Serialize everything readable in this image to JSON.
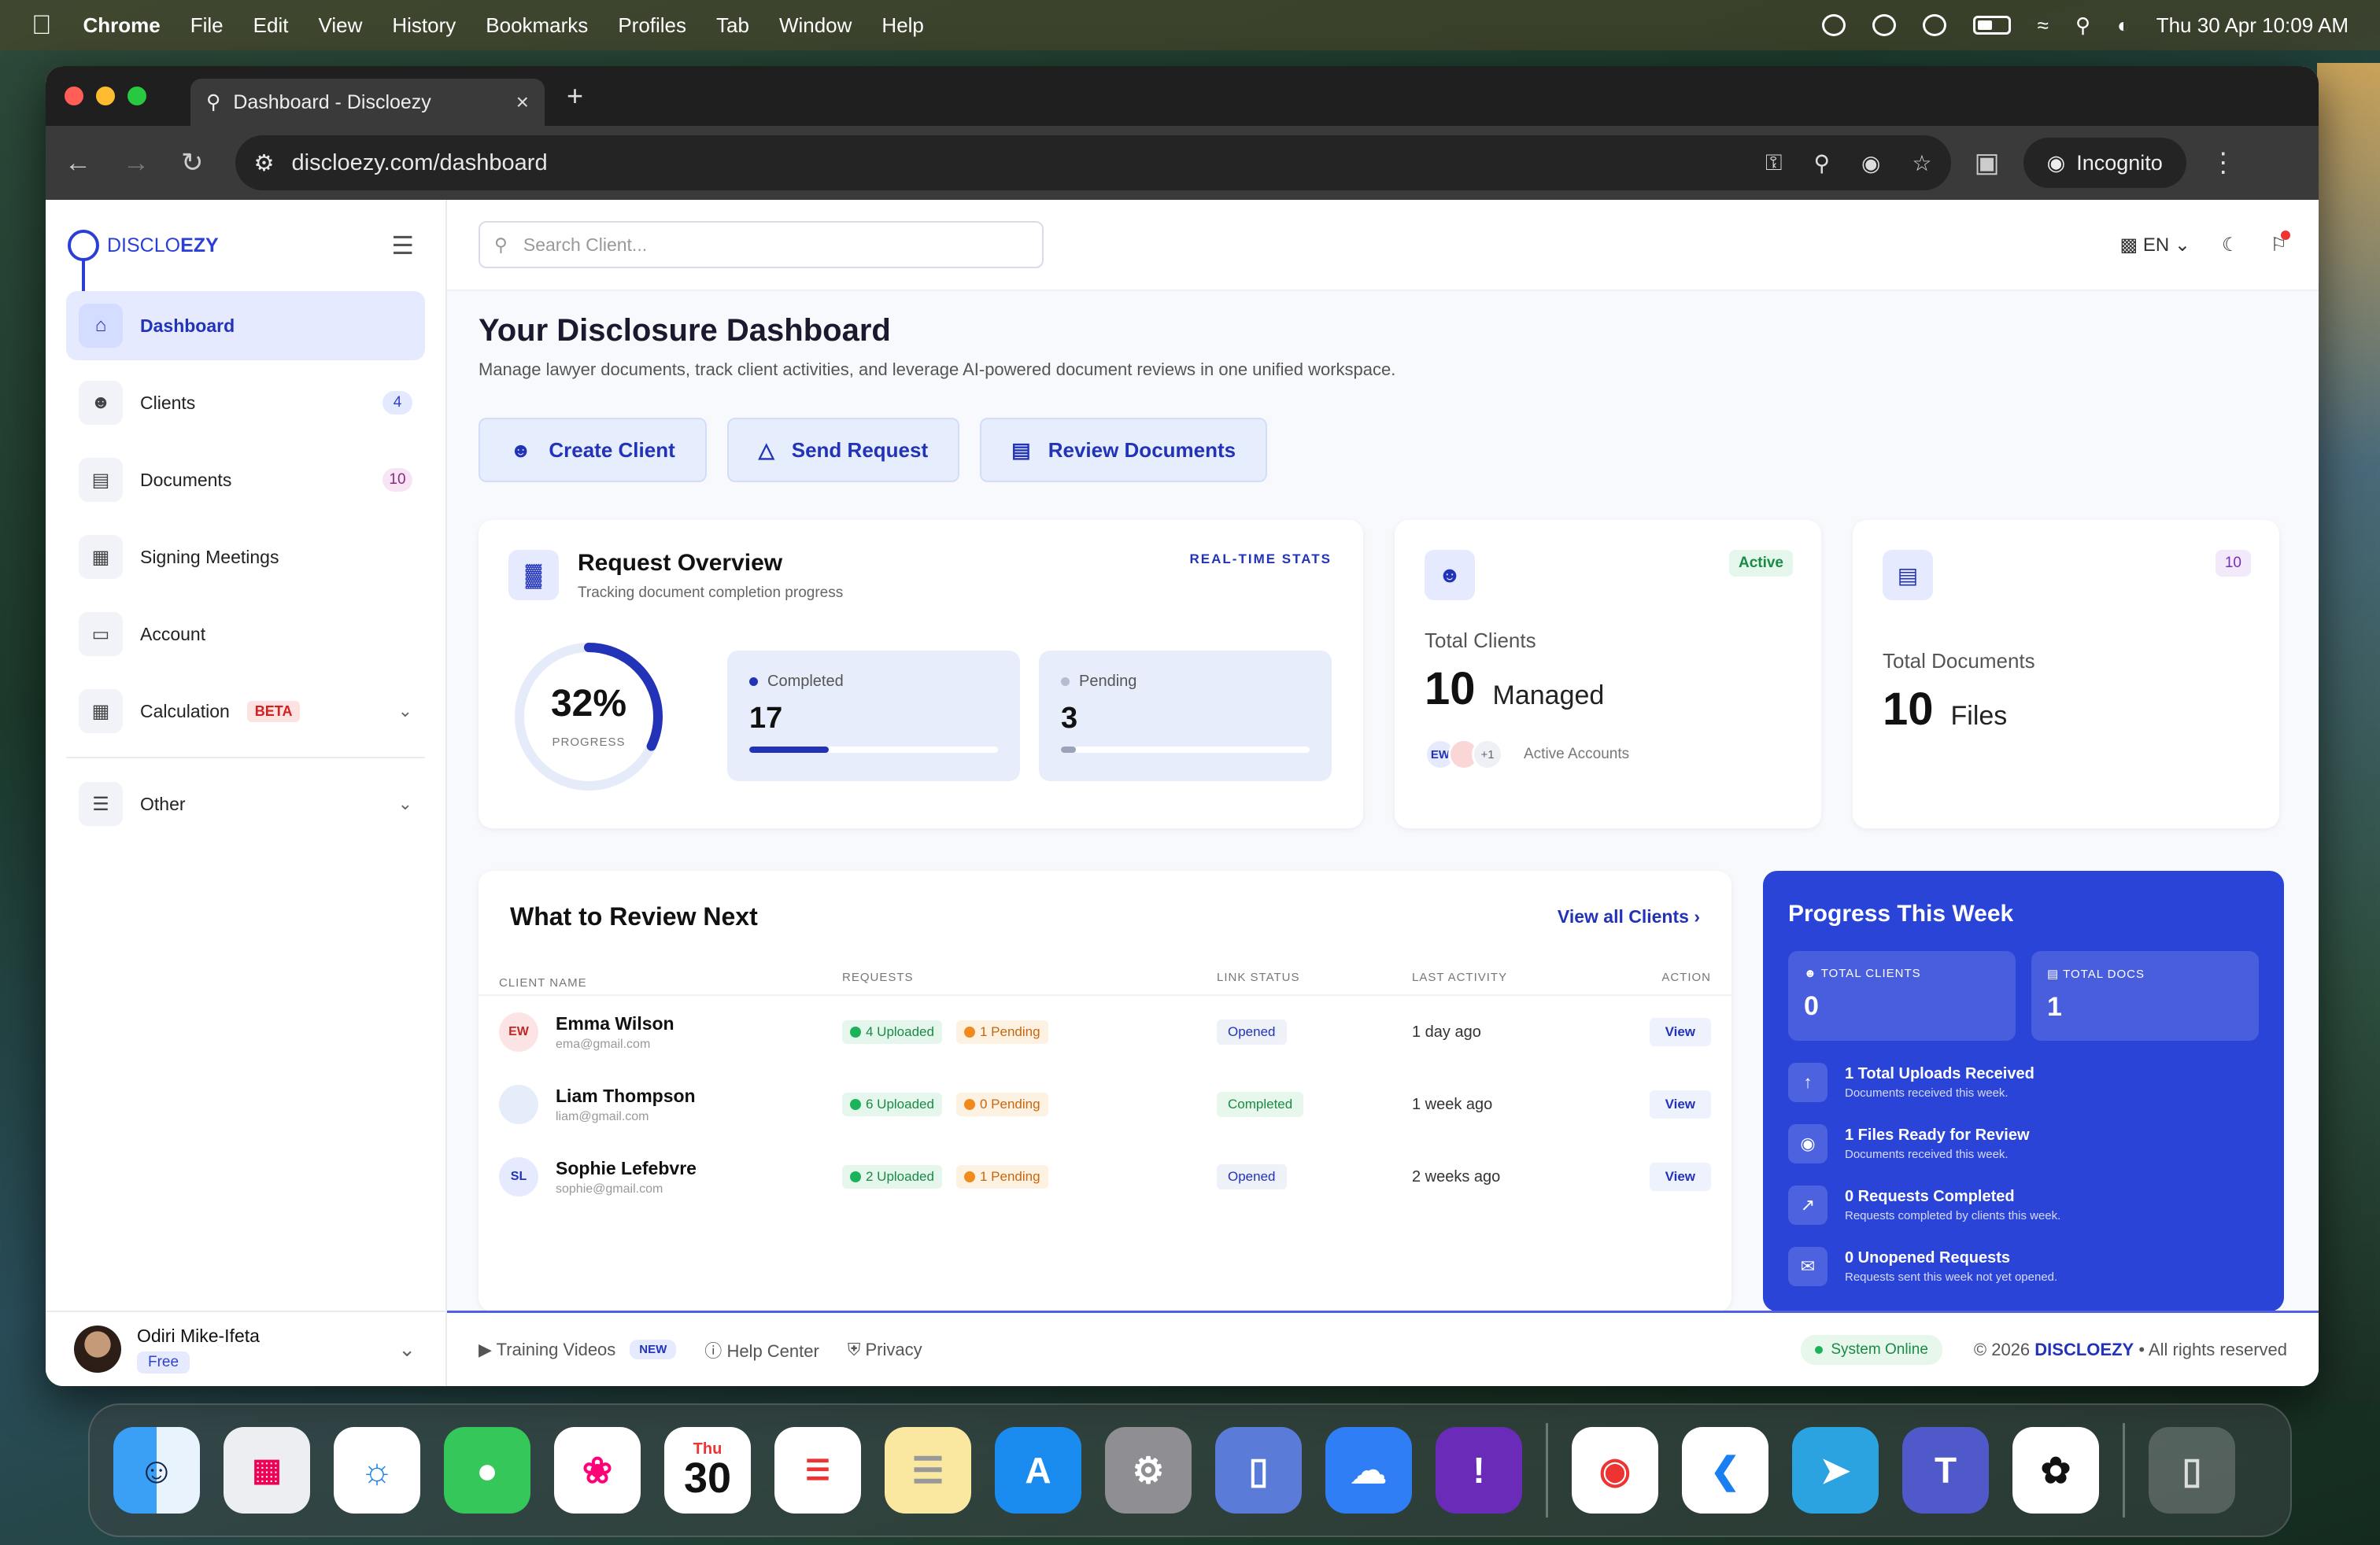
{
  "menubar": {
    "app": "Chrome",
    "items": [
      "File",
      "Edit",
      "View",
      "History",
      "Bookmarks",
      "Profiles",
      "Tab",
      "Window",
      "Help"
    ],
    "datetime": "Thu 30 Apr  10:09 AM"
  },
  "browser": {
    "tab_title": "Dashboard - Discloezy",
    "url": "discloezy.com/dashboard",
    "incognito_label": "Incognito"
  },
  "sidebar": {
    "logo_prefix": "DISCLO",
    "logo_suffix": "EZY",
    "items": [
      {
        "label": "Dashboard",
        "icon": "home-icon"
      },
      {
        "label": "Clients",
        "badge": "4",
        "icon": "users-icon"
      },
      {
        "label": "Documents",
        "badge": "10",
        "icon": "document-icon"
      },
      {
        "label": "Signing Meetings",
        "icon": "calendar-icon"
      },
      {
        "label": "Account",
        "icon": "card-icon"
      },
      {
        "label": "Calculation",
        "tag": "BETA",
        "icon": "calculator-icon"
      }
    ],
    "other_label": "Other",
    "user": {
      "name": "Odiri Mike-Ifeta",
      "plan": "Free"
    }
  },
  "topbar": {
    "search_placeholder": "Search Client...",
    "language": "EN"
  },
  "main": {
    "title": "Your Disclosure Dashboard",
    "subtitle": "Manage lawyer documents, track client activities, and leverage AI-powered document reviews in one unified workspace.",
    "actions": [
      "Create Client",
      "Send Request",
      "Review Documents"
    ]
  },
  "request_overview": {
    "title": "Request Overview",
    "subtitle": "Tracking document completion progress",
    "tag": "REAL-TIME STATS",
    "progress_label": "32%",
    "progress_value": 0.32,
    "progress_caption": "PROGRESS",
    "completed": {
      "label": "Completed",
      "value": "17",
      "fraction": 0.32
    },
    "pending": {
      "label": "Pending",
      "value": "3",
      "fraction": 0.06
    }
  },
  "total_clients": {
    "tag": "Active",
    "label": "Total Clients",
    "value": "10",
    "unit": "Managed",
    "avatar_initials": "EW",
    "more": "+1",
    "accounts_label": "Active Accounts"
  },
  "total_documents": {
    "tag": "10",
    "label": "Total Documents",
    "value": "10",
    "unit": "Files"
  },
  "review": {
    "title": "What to Review Next",
    "view_all": "View all Clients",
    "columns": [
      "CLIENT NAME",
      "REQUESTS",
      "LINK STATUS",
      "LAST ACTIVITY",
      "ACTION"
    ],
    "rows": [
      {
        "initials": "EW",
        "name": "Emma Wilson",
        "email": "ema@gmail.com",
        "uploaded": "4 Uploaded",
        "pending": "1 Pending",
        "status": "Opened",
        "activity": "1 day ago",
        "action": "View"
      },
      {
        "initials": "",
        "name": "Liam Thompson",
        "email": "liam@gmail.com",
        "uploaded": "6 Uploaded",
        "pending": "0 Pending",
        "status": "Completed",
        "activity": "1 week ago",
        "action": "View"
      },
      {
        "initials": "SL",
        "name": "Sophie Lefebvre",
        "email": "sophie@gmail.com",
        "uploaded": "2 Uploaded",
        "pending": "1 Pending",
        "status": "Opened",
        "activity": "2 weeks ago",
        "action": "View"
      }
    ]
  },
  "progress_week": {
    "title": "Progress This Week",
    "boxes": [
      {
        "label": "TOTAL CLIENTS",
        "value": "0"
      },
      {
        "label": "TOTAL DOCS",
        "value": "1"
      }
    ],
    "items": [
      {
        "title": "1 Total Uploads Received",
        "desc": "Documents received this week."
      },
      {
        "title": "1 Files Ready for Review",
        "desc": "Documents received this week."
      },
      {
        "title": "0 Requests Completed",
        "desc": "Requests completed by clients this week."
      },
      {
        "title": "0 Unopened Requests",
        "desc": "Requests sent this week not yet opened."
      }
    ]
  },
  "footer": {
    "training": "Training Videos",
    "new_tag": "NEW",
    "help": "Help Center",
    "privacy": "Privacy",
    "status": "System Online",
    "copyright_prefix": "© 2026",
    "brand": "DISCLOEZY",
    "copyright_suffix": "• All rights reserved"
  },
  "dock": {
    "calendar_day": "Thu",
    "calendar_date": "30"
  },
  "colors": {
    "primary": "#2233b8",
    "progress_panel": "#2b44d8",
    "success": "#1a8a45",
    "warning": "#c8660f"
  }
}
